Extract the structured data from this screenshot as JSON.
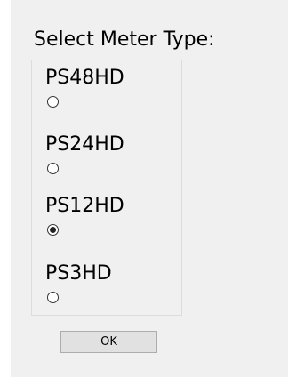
{
  "dialog": {
    "title": "Select Meter Type:",
    "options": [
      {
        "label": "PS48HD",
        "checked": false
      },
      {
        "label": "PS24HD",
        "checked": false
      },
      {
        "label": "PS12HD",
        "checked": true
      },
      {
        "label": "PS3HD",
        "checked": false
      }
    ],
    "ok_label": "OK"
  }
}
